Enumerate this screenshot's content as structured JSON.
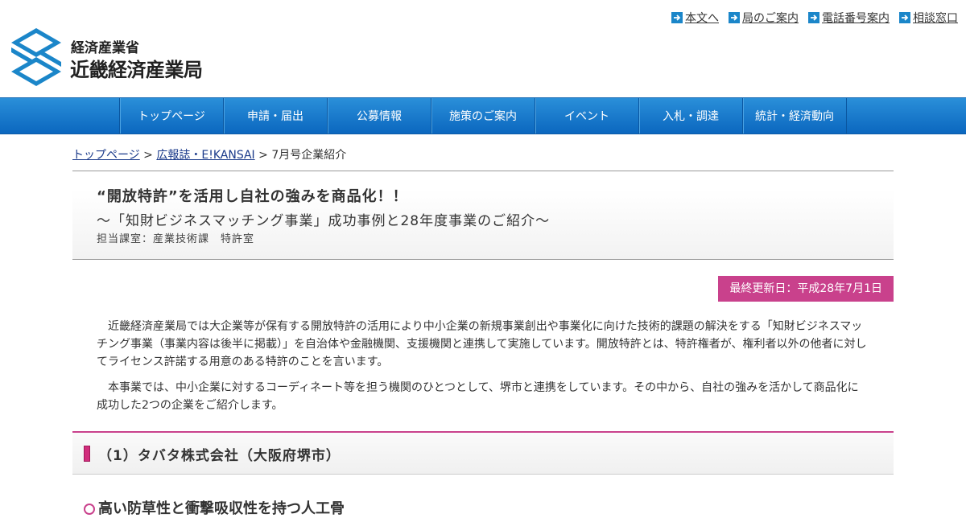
{
  "logo": {
    "ministry": "経済産業省",
    "bureau": "近畿経済産業局",
    "mark_color": "#1b86c9"
  },
  "util_links": [
    {
      "label": "本文へ",
      "icon": "arrow-right-icon"
    },
    {
      "label": "局のご案内",
      "icon": "arrow-right-icon"
    },
    {
      "label": "電話番号案内",
      "icon": "arrow-right-icon"
    },
    {
      "label": "相談窓口",
      "icon": "arrow-right-icon"
    }
  ],
  "nav": {
    "items": [
      "トップページ",
      "申請・届出",
      "公募情報",
      "施策のご案内",
      "イベント",
      "入札・調達",
      "統計・経済動向"
    ]
  },
  "breadcrumb": {
    "home": "トップページ",
    "sep1": " > ",
    "magazine": "広報誌・E!KANSAI",
    "sep2": " > ",
    "current": "7月号企業紹介"
  },
  "article": {
    "title": "“開放特許”を活用し自社の強みを商品化！！",
    "subtitle": "～「知財ビジネスマッチング事業」成功事例と28年度事業のご紹介～",
    "department": "担当課室：産業技術課　特許室",
    "updated": "最終更新日：平成28年7月1日",
    "paragraphs": [
      "近畿経済産業局では大企業等が保有する開放特許の活用により中小企業の新規事業創出や事業化に向けた技術的課題の解決をする「知財ビジネスマッチング事業（事業内容は後半に掲載）」を自治体や金融機関、支援機関と連携して実施しています。開放特許とは、特許権者が、権利者以外の他者に対してライセンス許諾する用意のある特許のことを言います。",
      "本事業では、中小企業に対するコーディネート等を担う機関のひとつとして、堺市と連携をしています。その中から、自社の強みを活かして商品化に成功した2つの企業をご紹介します。"
    ],
    "section1": "（1）タバタ株式会社（大阪府堺市）",
    "subsection1": "高い防草性と衝撃吸収性を持つ人工骨"
  },
  "colors": {
    "nav_blue": "#0b67bf",
    "accent_pink": "#c9418c"
  }
}
